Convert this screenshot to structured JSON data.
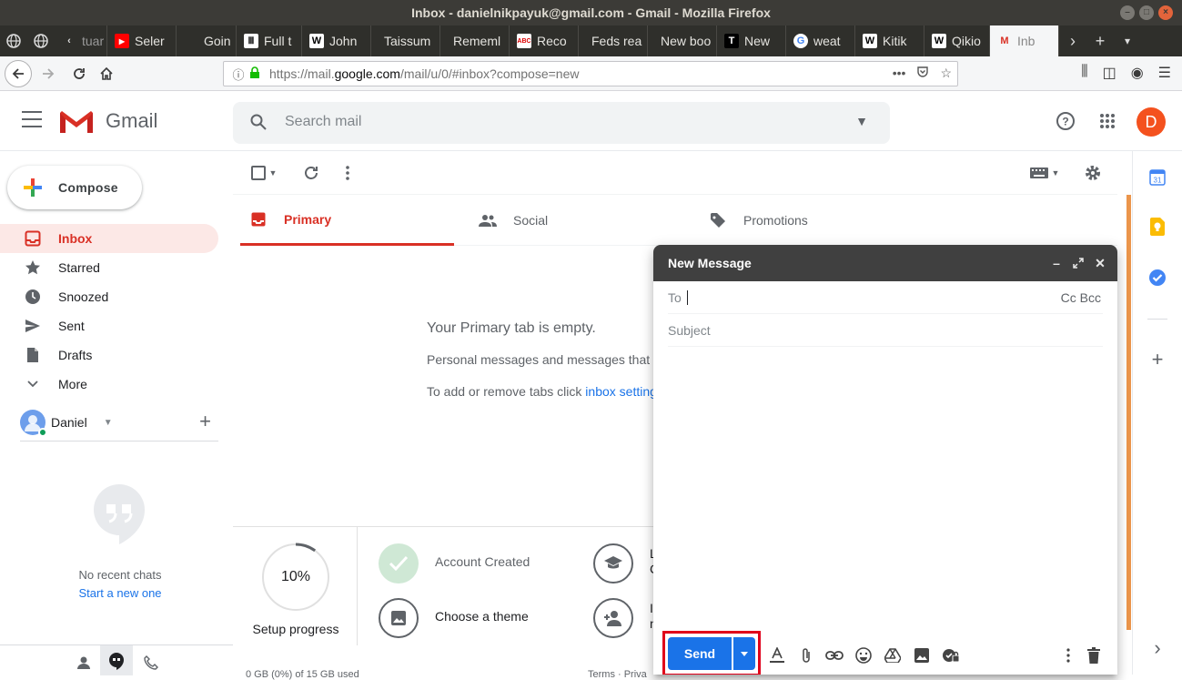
{
  "window": {
    "title": "Inbox - danielnikpayuk@gmail.com - Gmail - Mozilla Firefox"
  },
  "tabs": [
    {
      "label": "tuar",
      "icon": "back-arrow-icon"
    },
    {
      "label": "Seler",
      "icon": "youtube-icon"
    },
    {
      "label": "Goin",
      "icon": "blank-page-icon"
    },
    {
      "label": "Full t",
      "icon": "museum-icon"
    },
    {
      "label": "John",
      "icon": "wikipedia-icon"
    },
    {
      "label": "Taissum",
      "icon": "blank-page-icon"
    },
    {
      "label": "Rememl",
      "icon": "blank-page-icon"
    },
    {
      "label": "Reco",
      "icon": "abc-news-icon"
    },
    {
      "label": "Feds rea",
      "icon": "blank-page-icon"
    },
    {
      "label": "New boo",
      "icon": "blank-page-icon"
    },
    {
      "label": "New",
      "icon": "nyt-icon"
    },
    {
      "label": "weat",
      "icon": "google-icon"
    },
    {
      "label": "Kitik",
      "icon": "wikipedia-icon"
    },
    {
      "label": "Qikio",
      "icon": "wikipedia-icon"
    },
    {
      "label": "Inb",
      "icon": "gmail-icon",
      "active": true
    }
  ],
  "urlbar": {
    "url_prefix": "https://mail.",
    "url_domain": "google.com",
    "url_suffix": "/mail/u/0/#inbox?compose=new"
  },
  "gmail": {
    "app_name": "Gmail",
    "search_placeholder": "Search mail",
    "account_initial": "D",
    "compose_label": "Compose",
    "nav": [
      {
        "label": "Inbox",
        "icon": "inbox-icon",
        "active": true
      },
      {
        "label": "Starred",
        "icon": "star-icon"
      },
      {
        "label": "Snoozed",
        "icon": "clock-icon"
      },
      {
        "label": "Sent",
        "icon": "send-icon"
      },
      {
        "label": "Drafts",
        "icon": "draft-icon"
      },
      {
        "label": "More",
        "icon": "chevron-down-icon"
      }
    ],
    "hangouts": {
      "user_name": "Daniel",
      "no_chats": "No recent chats",
      "start_chat": "Start a new one"
    },
    "categories": [
      {
        "label": "Primary",
        "icon": "inbox-icon",
        "active": true
      },
      {
        "label": "Social",
        "icon": "people-icon"
      },
      {
        "label": "Promotions",
        "icon": "tag-icon"
      }
    ],
    "empty_state": {
      "title": "Your Primary tab is empty.",
      "line1": "Personal messages and messages that d",
      "line2_prefix": "To add or remove tabs click ",
      "line2_link": "inbox setting"
    },
    "setup": {
      "progress_value": "10%",
      "progress_fraction": 0.1,
      "progress_label": "Setup progress",
      "steps": [
        {
          "label": "Account Created",
          "done": true
        },
        {
          "label": "Choose a theme",
          "done": false
        },
        {
          "label": "L",
          "label2": "C",
          "done": false
        },
        {
          "label": "I",
          "label2": "n",
          "done": false
        }
      ]
    },
    "footer_left": "0 GB (0%) of 15 GB used",
    "footer_right": "Terms · Priva"
  },
  "compose_window": {
    "title": "New Message",
    "to_label": "To",
    "cc_bcc": "Cc Bcc",
    "subject_placeholder": "Subject",
    "send_label": "Send"
  },
  "colors": {
    "gmail_red": "#d93025",
    "send_blue": "#1a73e8",
    "highlight_frame": "#e0001a"
  }
}
